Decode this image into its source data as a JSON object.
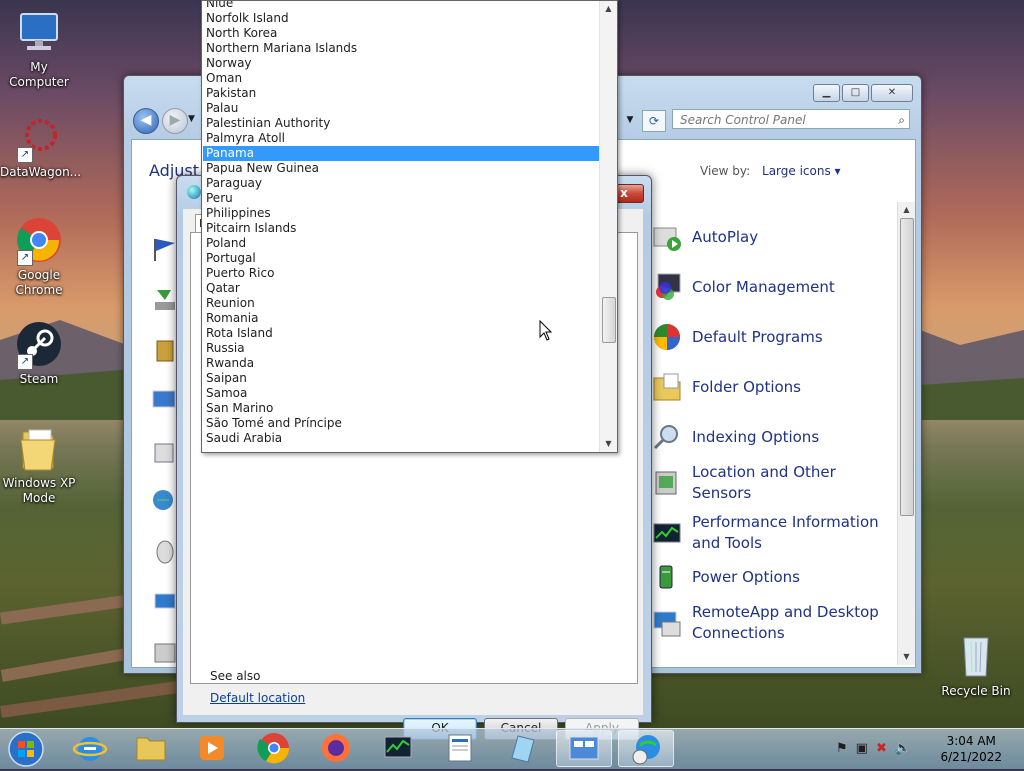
{
  "desktop": {
    "icons": [
      {
        "label": "My Computer"
      },
      {
        "label": "DataWagon..."
      },
      {
        "label": "Google Chrome"
      },
      {
        "label": "Steam"
      },
      {
        "label": "Windows XP Mode"
      },
      {
        "label": "Recycle Bin"
      }
    ]
  },
  "control_panel": {
    "search_placeholder": "Search Control Panel",
    "heading_partial": "Adjust y",
    "view_by_label": "View by:",
    "view_by_value": "Large icons",
    "items": [
      {
        "label": "AutoPlay"
      },
      {
        "label": "Color Management"
      },
      {
        "label": "Default Programs"
      },
      {
        "label": "Folder Options"
      },
      {
        "label": "Indexing Options"
      },
      {
        "label": "Location and Other Sensors"
      },
      {
        "label": "Performance Information and Tools"
      },
      {
        "label": "Power Options"
      },
      {
        "label": "RemoteApp and Desktop Connections"
      }
    ]
  },
  "dialog": {
    "tab_stub": "F",
    "see_also": "See also",
    "default_location_link": "Default location",
    "ok_label": "OK",
    "cancel_label": "Cancel",
    "apply_label": "Apply",
    "close_glyph": "x"
  },
  "dropdown": {
    "selected": "Panama",
    "items": [
      "Niue",
      "Norfolk Island",
      "North Korea",
      "Northern Mariana Islands",
      "Norway",
      "Oman",
      "Pakistan",
      "Palau",
      "Palestinian Authority",
      "Palmyra Atoll",
      "Panama",
      "Papua New Guinea",
      "Paraguay",
      "Peru",
      "Philippines",
      "Pitcairn Islands",
      "Poland",
      "Portugal",
      "Puerto Rico",
      "Qatar",
      "Reunion",
      "Romania",
      "Rota Island",
      "Russia",
      "Rwanda",
      "Saipan",
      "Samoa",
      "San Marino",
      "São Tomé and Príncipe",
      "Saudi Arabia"
    ]
  },
  "taskbar": {
    "time": "3:04 AM",
    "date": "6/21/2022"
  },
  "colors": {
    "selection": "#3399ff",
    "link": "#1e3287"
  }
}
